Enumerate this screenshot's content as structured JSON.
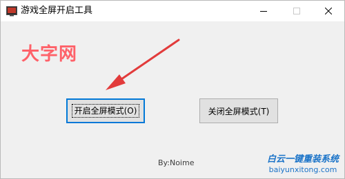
{
  "window": {
    "title": "游戏全屏开启工具"
  },
  "watermark": {
    "logo_text": "大字网",
    "site_title": "白云一键重装系统",
    "site_url": "baiyunxitong.com"
  },
  "buttons": {
    "open_fullscreen": "开启全屏模式(O)",
    "close_fullscreen": "关闭全屏模式(T)"
  },
  "footer": {
    "byline": "By:Noime"
  },
  "colors": {
    "arrow": "#e23b3b",
    "focus_border": "#0078d7",
    "logo": "#ff5a62",
    "site_watermark": "#1a73c8"
  }
}
